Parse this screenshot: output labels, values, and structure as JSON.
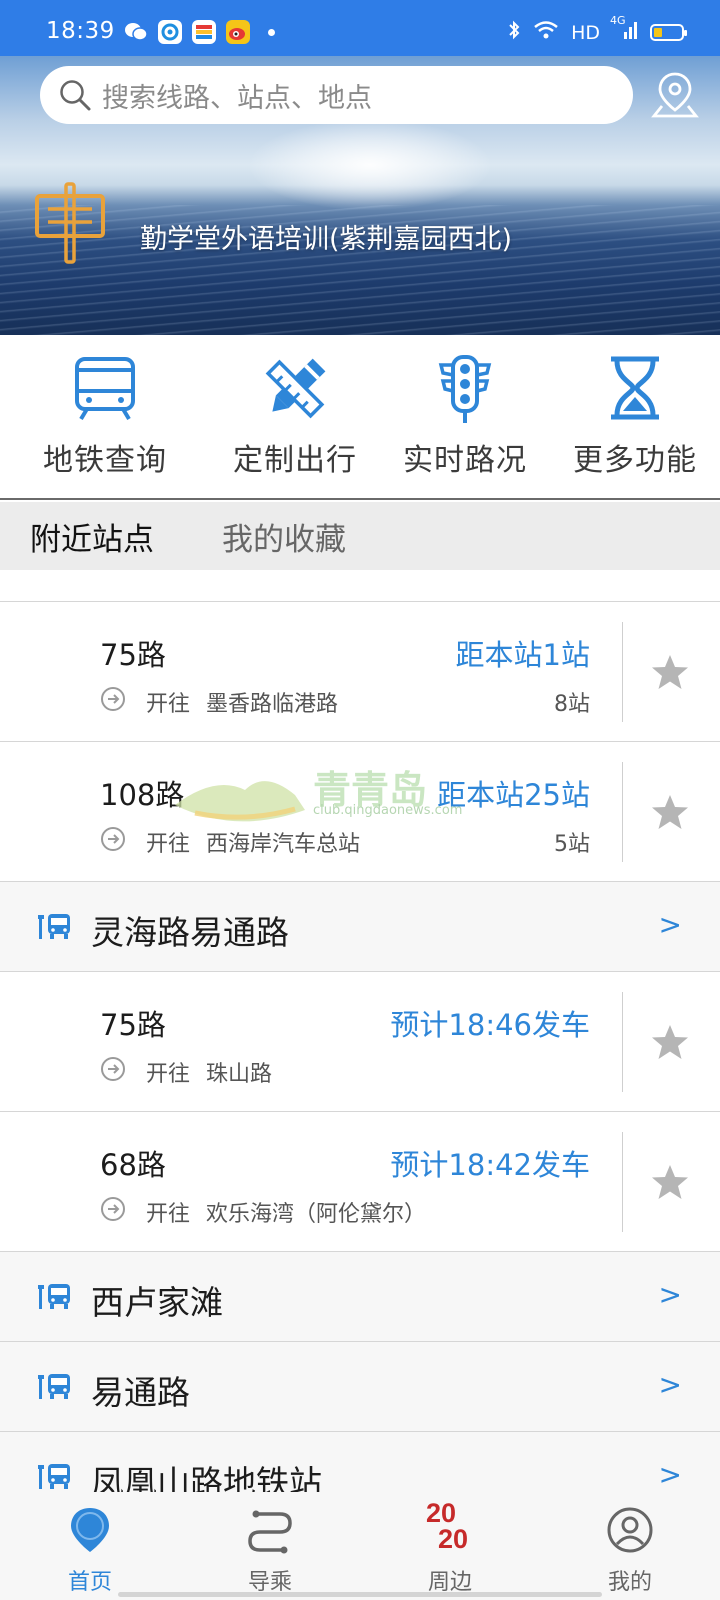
{
  "status_bar": {
    "time": "18:39",
    "network": "HD",
    "signal_badge": "4G"
  },
  "search": {
    "placeholder": "搜索线路、站点、地点"
  },
  "hero": {
    "current_station": "勤学堂外语培训(紫荆嘉园西北)"
  },
  "features": [
    {
      "label": "地铁查询",
      "icon": "subway-icon"
    },
    {
      "label": "定制出行",
      "icon": "pencil-ruler-icon"
    },
    {
      "label": "实时路况",
      "icon": "traffic-light-icon"
    },
    {
      "label": "更多功能",
      "icon": "hourglass-icon"
    }
  ],
  "tabs": [
    {
      "label": "附近站点",
      "active": true
    },
    {
      "label": "我的收藏",
      "active": false
    }
  ],
  "list": {
    "routes_a": [
      {
        "name": "75路",
        "info": "距本站1站",
        "dir_label": "开往",
        "destination": "墨香路临港路",
        "stops": "8站"
      },
      {
        "name": "108路",
        "info": "距本站25站",
        "dir_label": "开往",
        "destination": "西海岸汽车总站",
        "stops": "5站"
      }
    ],
    "station_1": {
      "name": "灵海路易通路",
      "arrow": ">"
    },
    "routes_b": [
      {
        "name": "75路",
        "info": "预计18:46发车",
        "dir_label": "开往",
        "destination": "珠山路",
        "stops": ""
      },
      {
        "name": "68路",
        "info": "预计18:42发车",
        "dir_label": "开往",
        "destination": "欢乐海湾（阿伦黛尔）",
        "stops": ""
      }
    ],
    "stations_more": [
      {
        "name": "西卢家滩",
        "arrow": ">"
      },
      {
        "name": "易通路",
        "arrow": ">"
      },
      {
        "name": "凤凰山路地铁站",
        "arrow": ">"
      }
    ]
  },
  "watermark": {
    "text": "青青岛",
    "url": "club.qingdaonews.com"
  },
  "bottom_nav": [
    {
      "label": "首页",
      "active": true,
      "icon": "location-pin-icon"
    },
    {
      "label": "导乘",
      "active": false,
      "icon": "route-icon"
    },
    {
      "label": "周边",
      "active": false,
      "icon": "year-2020-icon",
      "badge_top": "20",
      "badge_bottom": "20"
    },
    {
      "label": "我的",
      "active": false,
      "icon": "user-icon"
    }
  ],
  "colors": {
    "accent": "#2e86d8",
    "status_bar": "#2f7de7",
    "star": "#b5b5b5",
    "badge_red": "#c62a2a",
    "sign_orange": "#e9a23b"
  }
}
